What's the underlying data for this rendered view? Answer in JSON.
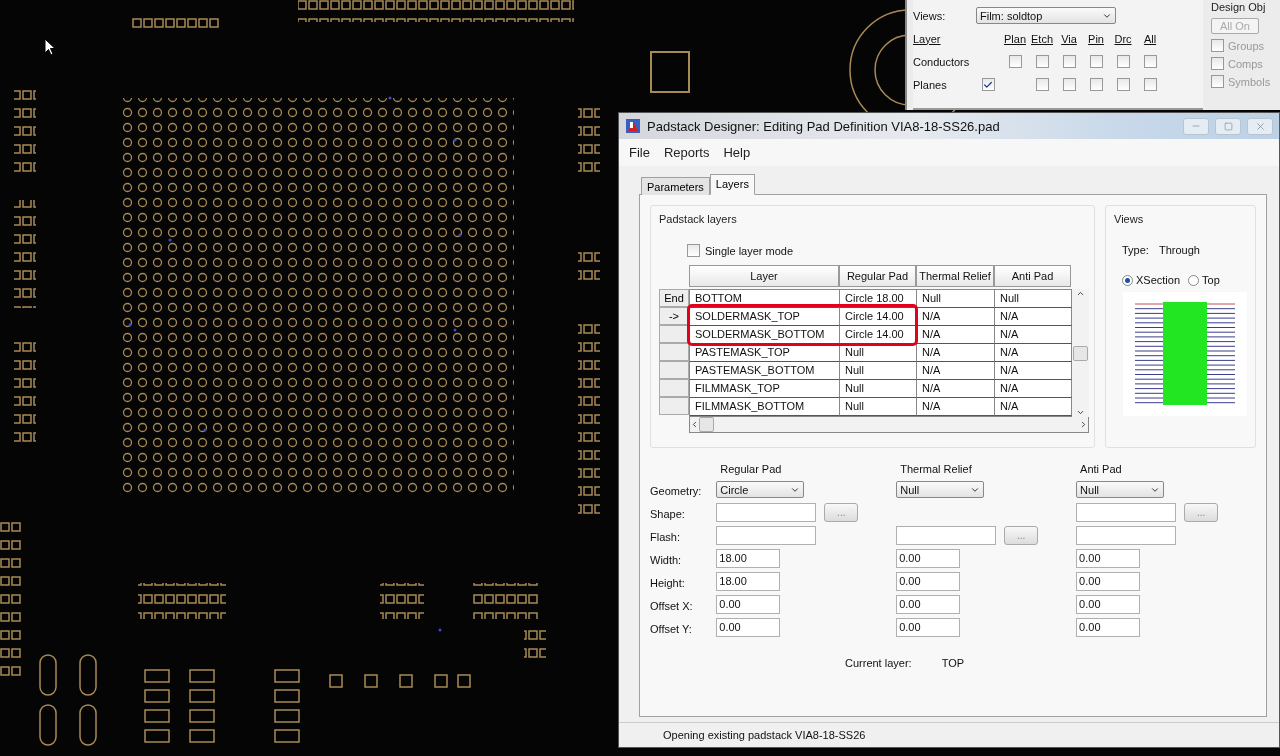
{
  "layer_panel": {
    "views_label": "Views:",
    "views_value": "Film: soldtop",
    "layer_header": "Layer",
    "column_headers": [
      "Plan",
      "Etch",
      "Via",
      "Pin",
      "Drc",
      "All"
    ],
    "rows": [
      {
        "label": "Conductors",
        "lead": {
          "kind": "blank"
        },
        "cells": [
          {
            "kind": "checkbox",
            "checked": false
          },
          {
            "kind": "checkbox",
            "checked": false
          },
          {
            "kind": "checkbox",
            "checked": false
          },
          {
            "kind": "checkbox",
            "checked": false
          },
          {
            "kind": "checkbox",
            "checked": false
          },
          {
            "kind": "checkbox",
            "checked": false
          }
        ]
      },
      {
        "label": "Planes",
        "lead": {
          "kind": "checkbox",
          "checked": true
        },
        "cells": [
          {
            "kind": "blank"
          },
          {
            "kind": "checkbox",
            "checked": false
          },
          {
            "kind": "checkbox",
            "checked": false
          },
          {
            "kind": "checkbox",
            "checked": false
          },
          {
            "kind": "checkbox",
            "checked": false
          },
          {
            "kind": "checkbox",
            "checked": false
          }
        ]
      }
    ],
    "design_objects": {
      "title": "Design Obj",
      "all_on": {
        "label": "All On",
        "disabled": true
      },
      "options": [
        {
          "label": "Groups",
          "checked": false
        },
        {
          "label": "Comps",
          "checked": false
        },
        {
          "label": "Symbols",
          "checked": false
        }
      ]
    }
  },
  "dialog": {
    "title": "Padstack Designer: Editing Pad Definition VIA8-18-SS26.pad",
    "menu": [
      "File",
      "Reports",
      "Help"
    ],
    "tabs": [
      {
        "label": "Parameters",
        "selected": false
      },
      {
        "label": "Layers",
        "selected": true
      }
    ],
    "padstack_layers": {
      "title": "Padstack layers",
      "single_layer_mode": {
        "label": "Single layer mode",
        "checked": false
      },
      "columns": [
        "Layer",
        "Regular Pad",
        "Thermal Relief",
        "Anti Pad"
      ],
      "rows": [
        {
          "marker": "End",
          "cells": [
            "BOTTOM",
            "Circle 18.00",
            "Null",
            "Null"
          ],
          "highlighted": false
        },
        {
          "marker": "->",
          "cells": [
            "SOLDERMASK_TOP",
            "Circle 14.00",
            "N/A",
            "N/A"
          ],
          "highlighted": true
        },
        {
          "cells": [
            "SOLDERMASK_BOTTOM",
            "Circle 14.00",
            "N/A",
            "N/A"
          ],
          "highlighted": true
        },
        {
          "cells": [
            "PASTEMASK_TOP",
            "Null",
            "N/A",
            "N/A"
          ],
          "highlighted": false
        },
        {
          "cells": [
            "PASTEMASK_BOTTOM",
            "Null",
            "N/A",
            "N/A"
          ],
          "highlighted": false
        },
        {
          "cells": [
            "FILMMASK_TOP",
            "Null",
            "N/A",
            "N/A"
          ],
          "highlighted": false
        },
        {
          "cells": [
            "FILMMASK_BOTTOM",
            "Null",
            "N/A",
            "N/A"
          ],
          "highlighted": false
        }
      ]
    },
    "views": {
      "title": "Views",
      "type_label": "Type:",
      "type_value": "Through",
      "options": [
        {
          "label": "XSection",
          "selected": true
        },
        {
          "label": "Top",
          "selected": false
        }
      ]
    },
    "pad_rows": [
      "Geometry:",
      "Shape:",
      "Flash:",
      "Width:",
      "Height:",
      "Offset X:",
      "Offset Y:"
    ],
    "pad_columns": [
      {
        "heading": "Regular Pad",
        "cells": [
          {
            "kind": "select",
            "value": "Circle"
          },
          {
            "kind": "browse",
            "button": "..."
          },
          {
            "kind": "field"
          },
          {
            "kind": "field",
            "value": "18.00"
          },
          {
            "kind": "field",
            "value": "18.00"
          },
          {
            "kind": "field",
            "value": "0.00"
          },
          {
            "kind": "field",
            "value": "0.00"
          }
        ]
      },
      {
        "heading": "Thermal Relief",
        "cells": [
          {
            "kind": "select",
            "value": "Null"
          },
          {
            "kind": "none"
          },
          {
            "kind": "browse",
            "button": "..."
          },
          {
            "kind": "field",
            "value": "0.00"
          },
          {
            "kind": "field",
            "value": "0.00"
          },
          {
            "kind": "field",
            "value": "0.00"
          },
          {
            "kind": "field",
            "value": "0.00"
          }
        ]
      },
      {
        "heading": "Anti Pad",
        "cells": [
          {
            "kind": "select",
            "value": "Null"
          },
          {
            "kind": "browse",
            "button": "..."
          },
          {
            "kind": "field"
          },
          {
            "kind": "field",
            "value": "0.00"
          },
          {
            "kind": "field",
            "value": "0.00"
          },
          {
            "kind": "field",
            "value": "0.00"
          },
          {
            "kind": "field",
            "value": "0.00"
          }
        ]
      }
    ],
    "current_layer": {
      "label": "Current layer:",
      "value": "TOP"
    },
    "status": "Opening existing padstack VIA8-18-SS26"
  }
}
